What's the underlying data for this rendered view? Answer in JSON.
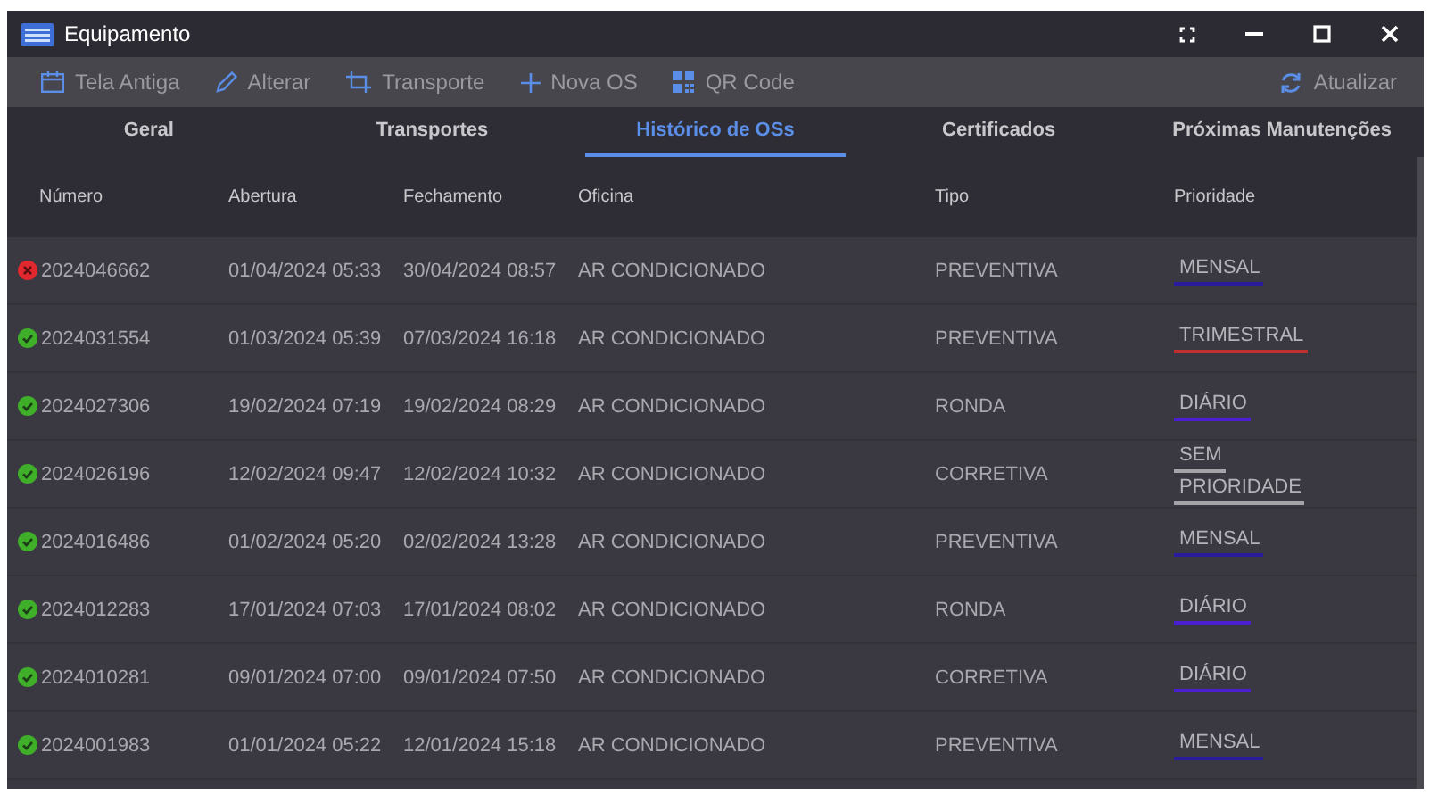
{
  "window": {
    "title": "Equipamento"
  },
  "toolbar": {
    "items": [
      {
        "kind": "calendar",
        "label": "Tela Antiga"
      },
      {
        "kind": "pencil",
        "label": "Alterar"
      },
      {
        "kind": "crop",
        "label": "Transporte"
      },
      {
        "kind": "plus",
        "label": "Nova OS"
      },
      {
        "kind": "qr",
        "label": "QR Code"
      }
    ],
    "refresh": {
      "label": "Atualizar"
    }
  },
  "tabs": [
    {
      "label": "Geral",
      "selected": false
    },
    {
      "label": "Transportes",
      "selected": false
    },
    {
      "label": "Histórico de OSs",
      "selected": true
    },
    {
      "label": "Certificados",
      "selected": false
    },
    {
      "label": "Próximas Manutenções",
      "selected": false
    }
  ],
  "table": {
    "columns": [
      "Número",
      "Abertura",
      "Fechamento",
      "Oficina",
      "Tipo",
      "Prioridade"
    ],
    "rows": [
      {
        "kind": "error",
        "numero": "2024046662",
        "abertura": "01/04/2024 05:33",
        "fechamento": "30/04/2024 08:57",
        "oficina": "AR CONDICIONADO",
        "tipo": "PREVENTIVA",
        "prioridade": {
          "lines": [
            "MENSAL"
          ],
          "color": "#2a1c9c"
        }
      },
      {
        "kind": "ok",
        "numero": "2024031554",
        "abertura": "01/03/2024 05:39",
        "fechamento": "07/03/2024 16:18",
        "oficina": "AR CONDICIONADO",
        "tipo": "PREVENTIVA",
        "prioridade": {
          "lines": [
            "TRIMESTRAL"
          ],
          "color": "#c0302f"
        }
      },
      {
        "kind": "ok",
        "numero": "2024027306",
        "abertura": "19/02/2024 07:19",
        "fechamento": "19/02/2024 08:29",
        "oficina": "AR CONDICIONADO",
        "tipo": "RONDA",
        "prioridade": {
          "lines": [
            "DIÁRIO"
          ],
          "color": "#4a1fd0"
        }
      },
      {
        "kind": "ok",
        "numero": "2024026196",
        "abertura": "12/02/2024 09:47",
        "fechamento": "12/02/2024 10:32",
        "oficina": "AR CONDICIONADO",
        "tipo": "CORRETIVA",
        "prioridade": {
          "lines": [
            "SEM",
            "PRIORIDADE"
          ],
          "color": "#a4a4a8"
        }
      },
      {
        "kind": "ok",
        "numero": "2024016486",
        "abertura": "01/02/2024 05:20",
        "fechamento": "02/02/2024 13:28",
        "oficina": "AR CONDICIONADO",
        "tipo": "PREVENTIVA",
        "prioridade": {
          "lines": [
            "MENSAL"
          ],
          "color": "#2a1c9c"
        }
      },
      {
        "kind": "ok",
        "numero": "2024012283",
        "abertura": "17/01/2024 07:03",
        "fechamento": "17/01/2024 08:02",
        "oficina": "AR CONDICIONADO",
        "tipo": "RONDA",
        "prioridade": {
          "lines": [
            "DIÁRIO"
          ],
          "color": "#4a1fd0"
        }
      },
      {
        "kind": "ok",
        "numero": "2024010281",
        "abertura": "09/01/2024 07:00",
        "fechamento": "09/01/2024 07:50",
        "oficina": "AR CONDICIONADO",
        "tipo": "CORRETIVA",
        "prioridade": {
          "lines": [
            "DIÁRIO"
          ],
          "color": "#4a1fd0"
        }
      },
      {
        "kind": "ok",
        "numero": "2024001983",
        "abertura": "01/01/2024 05:22",
        "fechamento": "12/01/2024 15:18",
        "oficina": "AR CONDICIONADO",
        "tipo": "PREVENTIVA",
        "prioridade": {
          "lines": [
            "MENSAL"
          ],
          "color": "#2a1c9c"
        }
      }
    ]
  }
}
